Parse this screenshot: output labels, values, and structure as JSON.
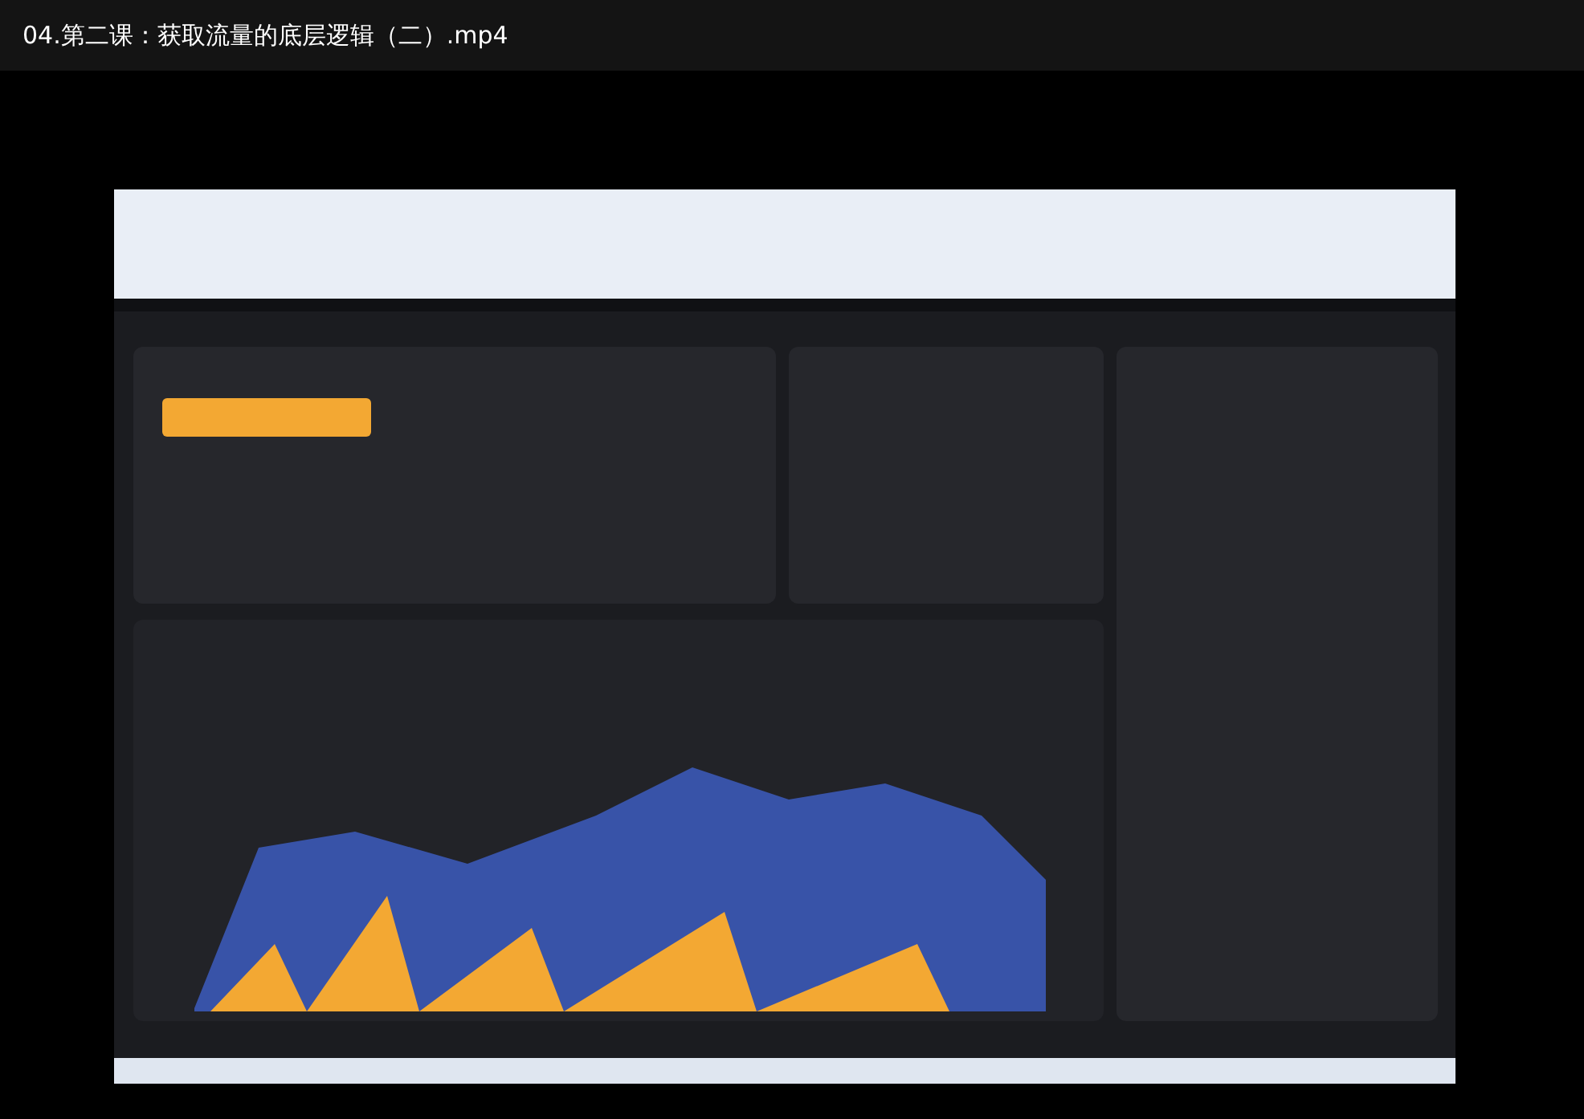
{
  "window": {
    "title": "04.第二课：获取流量的底层逻辑（二）.mp4"
  }
}
